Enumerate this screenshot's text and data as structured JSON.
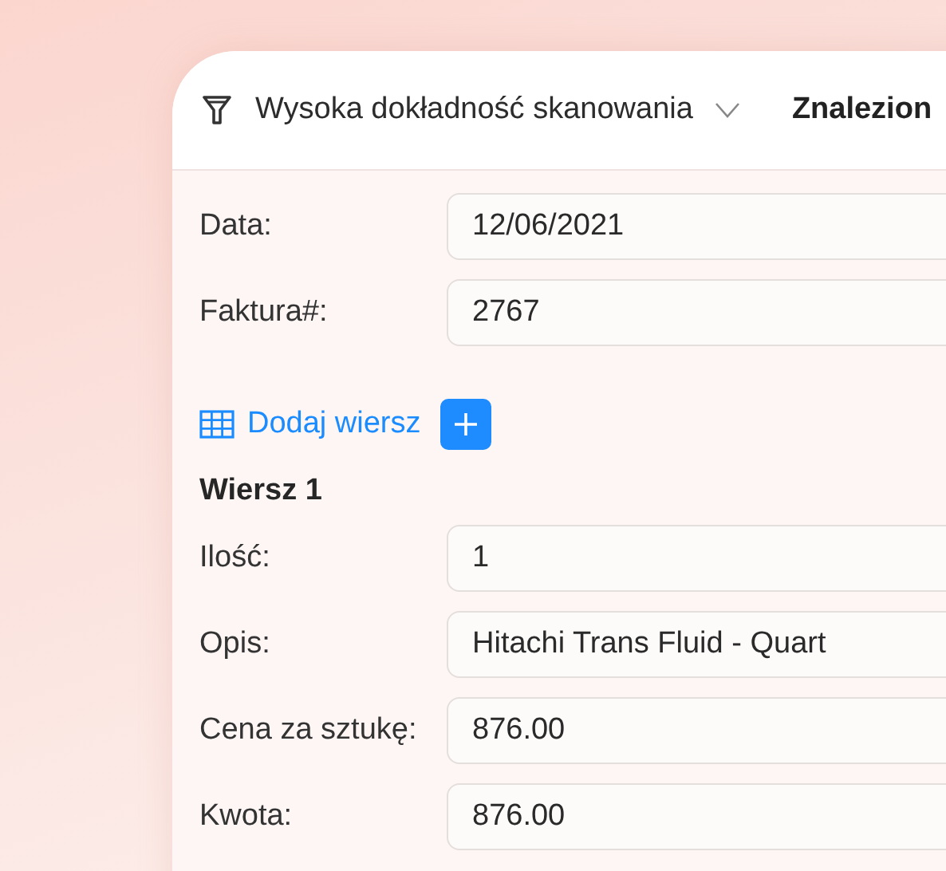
{
  "header": {
    "filter_label": "Wysoka dokładność skanowania",
    "found_label": "Znalezion"
  },
  "fields": [
    {
      "label": "Data:",
      "value": "12/06/2021"
    },
    {
      "label": "Faktura#:",
      "value": "2767"
    }
  ],
  "add_row": {
    "label": "Dodaj wiersz"
  },
  "row": {
    "title": "Wiersz 1",
    "fields": [
      {
        "label": "Ilość:",
        "value": "1"
      },
      {
        "label": "Opis:",
        "value": "Hitachi Trans Fluid - Quart"
      },
      {
        "label": "Cena za sztukę:",
        "value": "876.00"
      },
      {
        "label": "Kwota:",
        "value": "876.00"
      }
    ]
  }
}
